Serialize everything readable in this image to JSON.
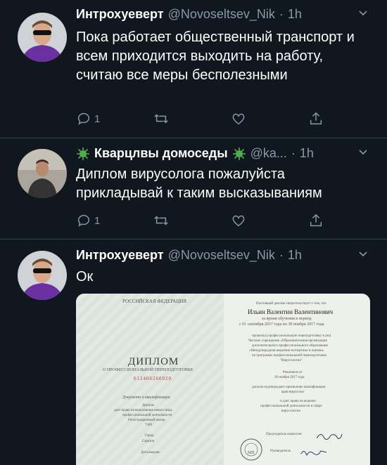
{
  "tweets": [
    {
      "name": "Интрохуеверт",
      "handle": "@Novoseltsev_Nik",
      "time": "1h",
      "text": "Пока работает общественный транспорт и всем приходится выходить на работу, считаю все меры бесполезными",
      "reply_count": "1"
    },
    {
      "name": "Кварцлвы домоседы",
      "handle": "@ka...",
      "time": "1h",
      "text": "Диплом вирусолога пожалуйста прикладывай к таким высказываниям",
      "reply_count": "1"
    },
    {
      "name": "Интрохуеверт",
      "handle": "@Novoseltsev_Nik",
      "time": "1h",
      "text": "Ок"
    }
  ],
  "diploma": {
    "country": "РОССИЙСКАЯ ФЕДЕРАЦИЯ",
    "title": "ДИПЛОМ",
    "subtitle": "О ПРОФЕССИОНАЛЬНОЙ ПЕРЕПОДГОТОВКЕ",
    "number": "612406260920",
    "doc_line": "Документ о квалификации",
    "left_text_1": "Диплом",
    "left_text_2": "дает право на выполнение нового вида",
    "left_text_3": "профессиональной деятельности",
    "reg_label": "Регистрационный номер",
    "reg_number": "7309",
    "city_label": "Город",
    "city": "Саратов",
    "date_label": "Дата выдачи",
    "header_right": "Настоящий диплом свидетельствует о том, что",
    "person": "Ильин Валентин Валентинович",
    "period_1": "за время обучения в период",
    "period_2": "с 01 сентября 2017 года по 30 ноября 2017 года",
    "r1": "прошел(а) профессиональную переподготовку в (на)",
    "r2": "Частное учреждение «Образовательная организация",
    "r3": "дополнительного профессионального образования",
    "r4": "«Международная академия экспертизы и оценки»",
    "r5": "по программе профессиональной переподготовки",
    "r6": "\"Вирусология\"",
    "decision": "Решением от",
    "decision_date": "30 ноября 2017 года",
    "r7": "диплом подтверждает присвоение квалификации",
    "r8": "врач-вирусолог",
    "r9": "и дает право на ведение",
    "r10": "профессиональной деятельности в сфере",
    "r11": "вирусологии",
    "chair": "Председатель комиссии",
    "head": "Руководитель",
    "mp": "МП"
  },
  "colors": {
    "background": "#10171e",
    "muted": "#8899a6",
    "divider": "#38444d",
    "virus": "#4caf50"
  }
}
